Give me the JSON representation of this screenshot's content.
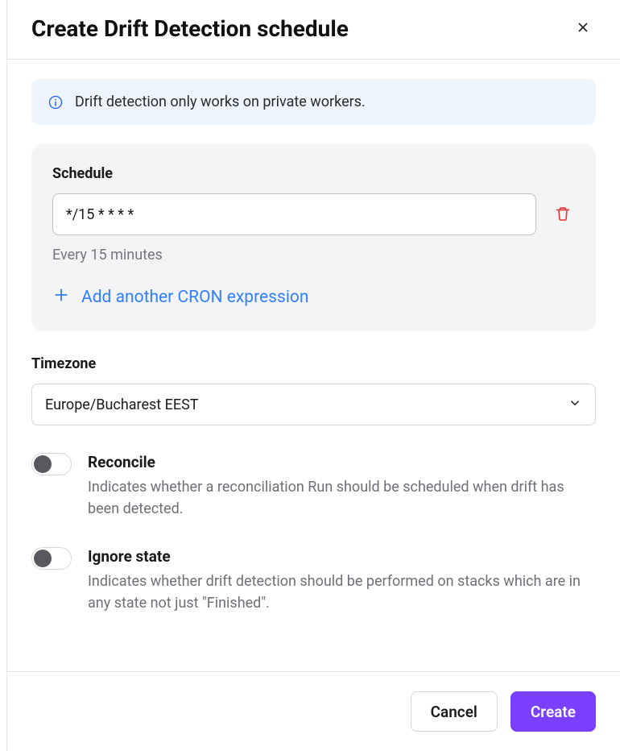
{
  "header": {
    "title": "Create Drift Detection schedule"
  },
  "info": {
    "text": "Drift detection only works on private workers."
  },
  "schedule": {
    "label": "Schedule",
    "cron_value": "*/15 * * * *",
    "hint": "Every 15 minutes",
    "add_label": "Add another CRON expression"
  },
  "timezone": {
    "label": "Timezone",
    "selected": "Europe/Bucharest EEST"
  },
  "toggles": {
    "reconcile": {
      "title": "Reconcile",
      "desc": "Indicates whether a reconciliation Run should be scheduled when drift has been detected."
    },
    "ignore_state": {
      "title": "Ignore state",
      "desc": "Indicates whether drift detection should be performed on stacks which are in any state not just \"Finished\"."
    }
  },
  "footer": {
    "cancel": "Cancel",
    "create": "Create"
  }
}
